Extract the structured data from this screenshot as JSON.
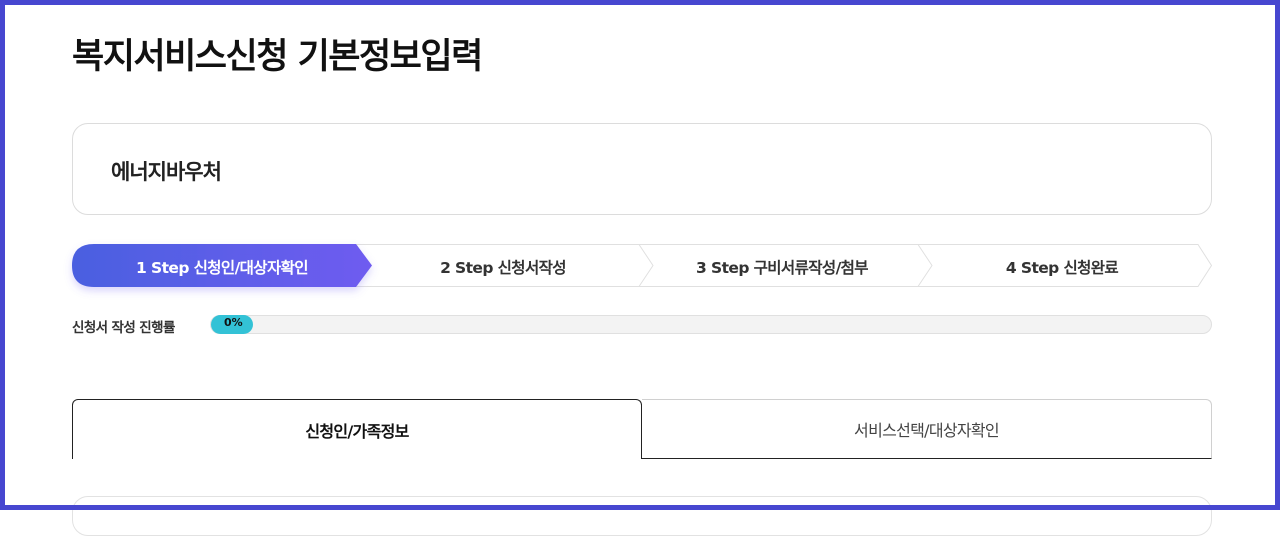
{
  "page": {
    "title": "복지서비스신청 기본정보입력"
  },
  "service": {
    "name": "에너지바우처"
  },
  "steps": {
    "items": [
      {
        "label": "1 Step 신청인/대상자확인",
        "active": true
      },
      {
        "label": "2 Step 신청서작성",
        "active": false
      },
      {
        "label": "3 Step 구비서류작성/첨부",
        "active": false
      },
      {
        "label": "4 Step 신청완료",
        "active": false
      }
    ],
    "colors": {
      "active_start": "#4a5fe0",
      "active_end": "#6f5cf0",
      "inactive_border": "#e0e0e0"
    }
  },
  "progress": {
    "label": "신청서 작성 진행률",
    "value_text": "0%",
    "value": 0,
    "color": "#33c2d6"
  },
  "tabs": [
    {
      "label": "신청인/가족정보",
      "active": true
    },
    {
      "label": "서비스선택/대상자확인",
      "active": false
    }
  ]
}
